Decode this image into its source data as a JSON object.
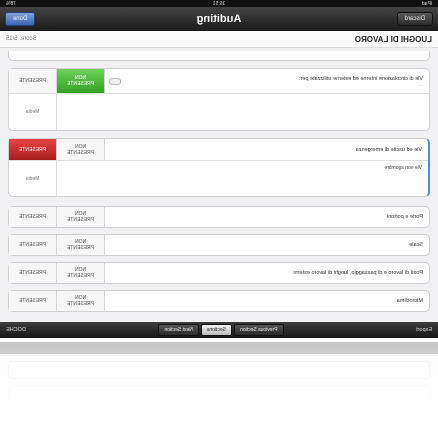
{
  "status_bar": {
    "carrier": "iPad",
    "time": "16:51",
    "battery": "78%"
  },
  "nav": {
    "title": "Auditing",
    "left_button": "Discard",
    "right_button": "Done"
  },
  "section": {
    "name": "LUOGHI DI LAVORO",
    "score": "Score: 5/15"
  },
  "segment_labels": {
    "present": "PRESENTE",
    "not_present_line1": "NON",
    "not_present_line2": "PRESENTE"
  },
  "items": [
    {
      "question": "Vie di circolazione interne ed esterne utilizzate per:",
      "subtext": "...",
      "selected": "not_present",
      "note": "",
      "note_label": "Media"
    },
    {
      "question": "Vie ed uscite di emergenza",
      "selected": "present",
      "note": "Vie non sgombre",
      "note_label": "Media"
    },
    {
      "question": "Porte e portoni"
    },
    {
      "question": "Scale"
    },
    {
      "question": "Posti di lavoro e di passaggio, luoghi di lavoro esterni"
    },
    {
      "question": "Microclima"
    }
  ],
  "tab_bar": {
    "left": "Export",
    "buttons": [
      "Previous Section",
      "Sections",
      "Next Section"
    ],
    "right": "DOCHE"
  },
  "colors": {
    "green": "#4cb83a",
    "red": "#c62828",
    "nav_dark": "#1b1b1b"
  }
}
